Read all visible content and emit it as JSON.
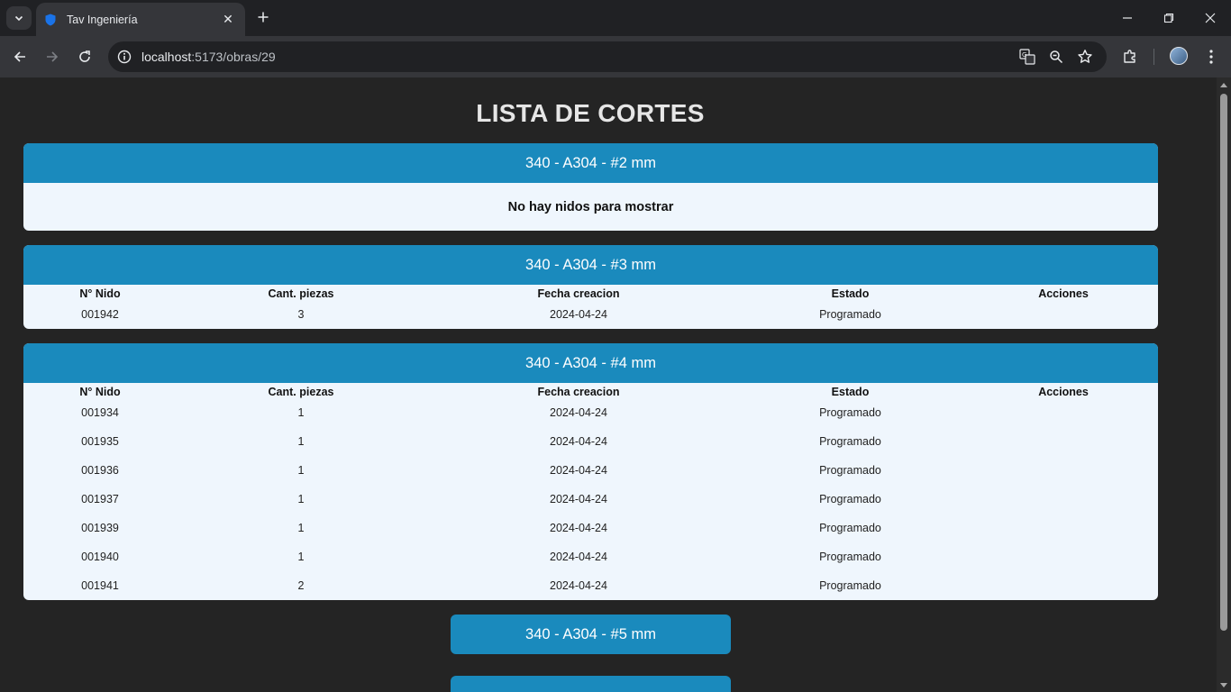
{
  "browser": {
    "tab_title": "Tav Ingeniería",
    "url_host": "localhost",
    "url_rest": ":5173/obras/29"
  },
  "page": {
    "title": "LISTA DE CORTES",
    "columns": [
      "N° Nido",
      "Cant. piezas",
      "Fecha creacion",
      "Estado",
      "Acciones"
    ],
    "sections": [
      {
        "header": "340 - A304 - #2 mm",
        "empty_message": "No hay nidos para mostrar",
        "rows": []
      },
      {
        "header": "340 - A304 - #3 mm",
        "rows": [
          {
            "nido": "001942",
            "piezas": "3",
            "fecha": "2024-04-24",
            "estado": "Programado",
            "acciones": ""
          }
        ]
      },
      {
        "header": "340 - A304 - #4 mm",
        "rows": [
          {
            "nido": "001934",
            "piezas": "1",
            "fecha": "2024-04-24",
            "estado": "Programado",
            "acciones": ""
          },
          {
            "nido": "001935",
            "piezas": "1",
            "fecha": "2024-04-24",
            "estado": "Programado",
            "acciones": ""
          },
          {
            "nido": "001936",
            "piezas": "1",
            "fecha": "2024-04-24",
            "estado": "Programado",
            "acciones": ""
          },
          {
            "nido": "001937",
            "piezas": "1",
            "fecha": "2024-04-24",
            "estado": "Programado",
            "acciones": ""
          },
          {
            "nido": "001939",
            "piezas": "1",
            "fecha": "2024-04-24",
            "estado": "Programado",
            "acciones": ""
          },
          {
            "nido": "001940",
            "piezas": "1",
            "fecha": "2024-04-24",
            "estado": "Programado",
            "acciones": ""
          },
          {
            "nido": "001941",
            "piezas": "2",
            "fecha": "2024-04-24",
            "estado": "Programado",
            "acciones": ""
          }
        ]
      },
      {
        "header": "340 - A304 - #5 mm",
        "collapsed": true
      }
    ]
  },
  "colors": {
    "header_blue": "#1a8abd",
    "card_bg": "#eff6fd",
    "page_bg": "#242424"
  }
}
